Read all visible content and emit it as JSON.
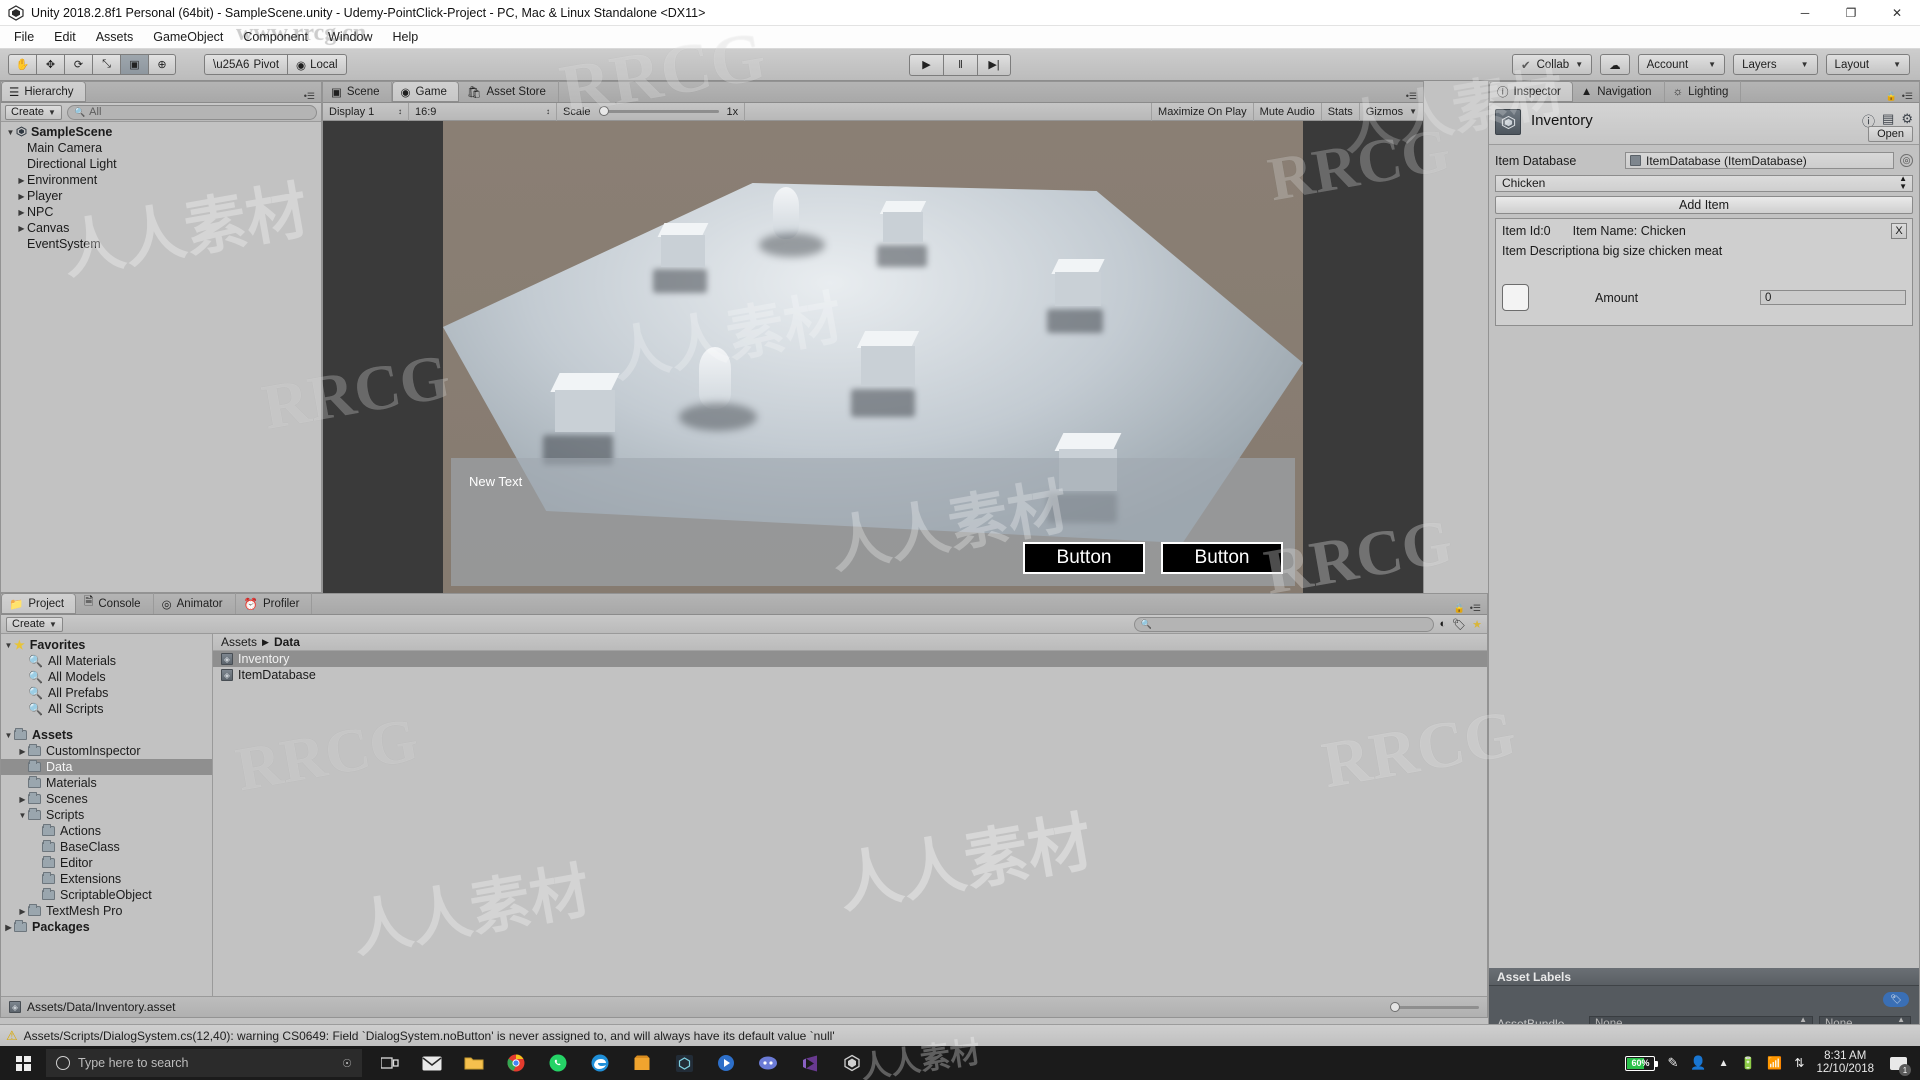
{
  "window": {
    "title": "Unity 2018.2.8f1 Personal (64bit) - SampleScene.unity - Udemy-PointClick-Project - PC, Mac & Linux Standalone <DX11>",
    "minimize": "─",
    "maximize": "❐",
    "close": "✕"
  },
  "menu": [
    "File",
    "Edit",
    "Assets",
    "GameObject",
    "Component",
    "Window",
    "Help"
  ],
  "toolbar": {
    "transform_tools": [
      {
        "name": "hand-tool",
        "glyph": "✋"
      },
      {
        "name": "move-tool",
        "glyph": "✥"
      },
      {
        "name": "rotate-tool",
        "glyph": "⟳"
      },
      {
        "name": "scale-tool",
        "glyph": "⤡"
      },
      {
        "name": "rect-tool",
        "glyph": "▣"
      },
      {
        "name": "transform-tool",
        "glyph": "⊕"
      }
    ],
    "pivot": "Pivot",
    "local": "Local",
    "play": "▶",
    "pause": "‖",
    "step": "▶|",
    "collab": "Collab",
    "cloud": "☁",
    "account": "Account",
    "layers": "Layers",
    "layout": "Layout"
  },
  "hierarchy": {
    "tab": "Hierarchy",
    "create": "Create",
    "search_placeholder": "All",
    "items": [
      {
        "label": "SampleScene",
        "depth": 0,
        "arrow": "open",
        "root": true
      },
      {
        "label": "Main Camera",
        "depth": 1,
        "arrow": "none"
      },
      {
        "label": "Directional Light",
        "depth": 1,
        "arrow": "none"
      },
      {
        "label": "Environment",
        "depth": 1,
        "arrow": "closed"
      },
      {
        "label": "Player",
        "depth": 1,
        "arrow": "closed"
      },
      {
        "label": "NPC",
        "depth": 1,
        "arrow": "closed"
      },
      {
        "label": "Canvas",
        "depth": 1,
        "arrow": "closed"
      },
      {
        "label": "EventSystem",
        "depth": 1,
        "arrow": "none"
      }
    ]
  },
  "gameview": {
    "tabs": [
      {
        "label": "Scene",
        "active": false
      },
      {
        "label": "Game",
        "active": true
      },
      {
        "label": "Asset Store",
        "active": false
      }
    ],
    "display": "Display 1",
    "aspect": "16:9",
    "scale_label": "Scale",
    "scale_value": "1x",
    "maximize_on_play": "Maximize On Play",
    "mute_audio": "Mute Audio",
    "stats": "Stats",
    "gizmos": "Gizmos",
    "canvas_text": "New Text",
    "button_1": "Button",
    "button_2": "Button"
  },
  "inspector": {
    "tabs": [
      {
        "label": "Inspector",
        "active": true
      },
      {
        "label": "Navigation",
        "active": false
      },
      {
        "label": "Lighting",
        "active": false
      }
    ],
    "asset_name": "Inventory",
    "open_button": "Open",
    "item_database_label": "Item Database",
    "item_database_value": "ItemDatabase (ItemDatabase)",
    "selected_item": "Chicken",
    "add_item_button": "Add Item",
    "entry": {
      "id_label": "Item Id:0",
      "name_label": "Item Name: Chicken",
      "description": "Item Descriptiona big size chicken meat",
      "remove": "X",
      "amount_label": "Amount",
      "amount_value": "0"
    },
    "asset_labels": {
      "title": "Asset Labels",
      "assetbundle_label": "AssetBundle",
      "bundle_value": "None",
      "variant_value": "None"
    }
  },
  "project": {
    "tabs": [
      {
        "label": "Project",
        "active": true
      },
      {
        "label": "Console",
        "active": false
      },
      {
        "label": "Animator",
        "active": false
      },
      {
        "label": "Profiler",
        "active": false
      }
    ],
    "create": "Create",
    "search_placeholder": "",
    "tree": [
      {
        "label": "Favorites",
        "depth": 0,
        "arrow": "open",
        "icon": "star",
        "bold": true
      },
      {
        "label": "All Materials",
        "depth": 1,
        "arrow": "none",
        "icon": "magnifier"
      },
      {
        "label": "All Models",
        "depth": 1,
        "arrow": "none",
        "icon": "magnifier"
      },
      {
        "label": "All Prefabs",
        "depth": 1,
        "arrow": "none",
        "icon": "magnifier"
      },
      {
        "label": "All Scripts",
        "depth": 1,
        "arrow": "none",
        "icon": "magnifier"
      },
      {
        "label": "",
        "depth": 0,
        "arrow": "none",
        "icon": "none",
        "spacer": true
      },
      {
        "label": "Assets",
        "depth": 0,
        "arrow": "open",
        "icon": "folder",
        "bold": true
      },
      {
        "label": "CustomInspector",
        "depth": 1,
        "arrow": "closed",
        "icon": "folder"
      },
      {
        "label": "Data",
        "depth": 1,
        "arrow": "none",
        "icon": "folder",
        "selected": true
      },
      {
        "label": "Materials",
        "depth": 1,
        "arrow": "none",
        "icon": "folder"
      },
      {
        "label": "Scenes",
        "depth": 1,
        "arrow": "closed",
        "icon": "folder"
      },
      {
        "label": "Scripts",
        "depth": 1,
        "arrow": "open",
        "icon": "folder"
      },
      {
        "label": "Actions",
        "depth": 2,
        "arrow": "none",
        "icon": "folder"
      },
      {
        "label": "BaseClass",
        "depth": 2,
        "arrow": "none",
        "icon": "folder"
      },
      {
        "label": "Editor",
        "depth": 2,
        "arrow": "none",
        "icon": "folder"
      },
      {
        "label": "Extensions",
        "depth": 2,
        "arrow": "none",
        "icon": "folder"
      },
      {
        "label": "ScriptableObject",
        "depth": 2,
        "arrow": "none",
        "icon": "folder"
      },
      {
        "label": "TextMesh Pro",
        "depth": 1,
        "arrow": "closed",
        "icon": "folder"
      },
      {
        "label": "Packages",
        "depth": 0,
        "arrow": "closed",
        "icon": "folder",
        "bold": true
      }
    ],
    "breadcrumb": [
      "Assets",
      "Data"
    ],
    "files": [
      {
        "label": "Inventory",
        "selected": true
      },
      {
        "label": "ItemDatabase",
        "selected": false
      }
    ],
    "footer_path": "Assets/Data/Inventory.asset"
  },
  "status": {
    "warning": "Assets/Scripts/DialogSystem.cs(12,40): warning CS0649: Field `DialogSystem.noButton' is never assigned to, and will always have its default value `null'"
  },
  "taskbar": {
    "search_placeholder": "Type here to search",
    "battery": "60%",
    "time": "8:31 AM",
    "date": "12/10/2018",
    "notification_count": "1",
    "apps": [
      "task-view",
      "mail",
      "file-explorer",
      "chrome",
      "whatsapp",
      "edge",
      "store",
      "unity-hub",
      "unity",
      "discord",
      "visual-studio",
      "unity-editor"
    ]
  },
  "watermarks": {
    "url": "www.rrcg.cn",
    "brand": "RRCG",
    "cn": "人人素材"
  },
  "colors": {
    "panel_bg": "#c2c2c2",
    "accent_blue": "#3a6fb5",
    "battery_green": "#2bc14a",
    "warning_yellow": "#d8a800"
  }
}
